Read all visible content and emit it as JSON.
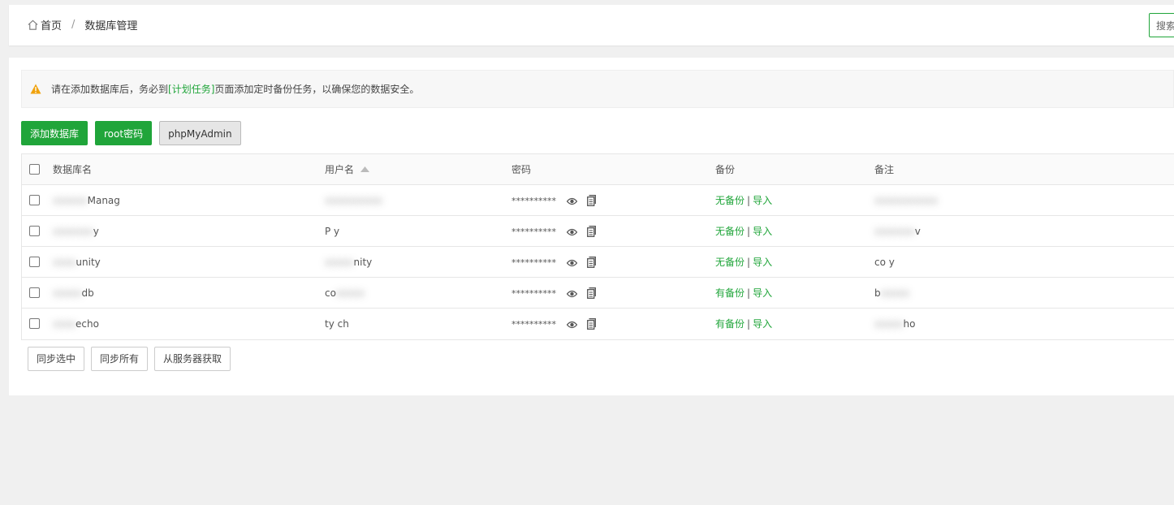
{
  "breadcrumb": {
    "home": "首页",
    "separator": "/",
    "current": "数据库管理"
  },
  "search": {
    "placeholder": "搜索"
  },
  "notice": {
    "before": "请在添加数据库后，务必到",
    "link": "[计划任务]",
    "after": "页面添加定时备份任务，以确保您的数据安全。"
  },
  "toolbar": {
    "add_db": "添加数据库",
    "root_password": "root密码",
    "phpmyadmin": "phpMyAdmin"
  },
  "table": {
    "headers": {
      "name": "数据库名",
      "user": "用户名",
      "password": "密码",
      "backup": "备份",
      "note": "备注"
    },
    "rows": [
      {
        "name": "Manag",
        "user": "",
        "password": "**********",
        "backup": "无备份",
        "import": "导入",
        "note": ""
      },
      {
        "name": "y",
        "user": "P y",
        "password": "**********",
        "backup": "无备份",
        "import": "导入",
        "note": "v"
      },
      {
        "name": "unity",
        "user": "nity",
        "password": "**********",
        "backup": "无备份",
        "import": "导入",
        "note": "co y"
      },
      {
        "name": "db",
        "user": "co",
        "password": "**********",
        "backup": "有备份",
        "import": "导入",
        "note": "b"
      },
      {
        "name": "echo",
        "user": "ty ch",
        "password": "**********",
        "backup": "有备份",
        "import": "导入",
        "note": "ho"
      }
    ]
  },
  "footer_buttons": {
    "sync_selected": "同步选中",
    "sync_all": "同步所有",
    "fetch_server": "从服务器获取"
  },
  "colors": {
    "accent": "#20a53a",
    "warning": "#f0a20d"
  }
}
